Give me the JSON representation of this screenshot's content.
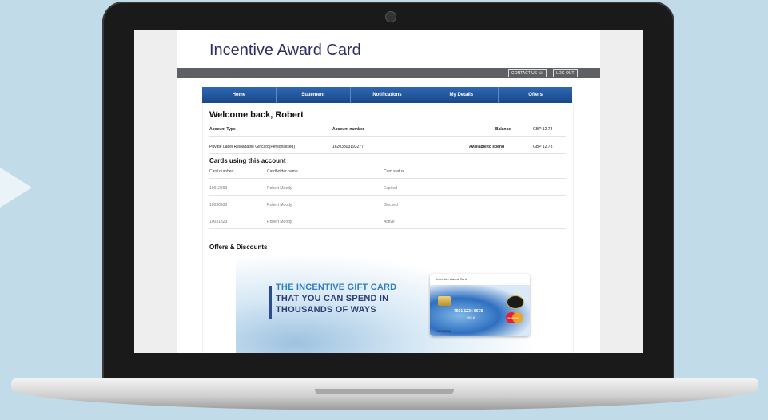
{
  "header": {
    "brand": "Incentive Award Card",
    "contact_label": "CONTACT US",
    "logout_label": "LOG OUT"
  },
  "nav": {
    "items": [
      "Home",
      "Statement",
      "Notifications",
      "My Details",
      "Offers"
    ]
  },
  "account": {
    "welcome": "Welcome back, Robert",
    "type_header": "Account Type",
    "number_header": "Account number",
    "balance_header": "Balance",
    "balance_value": "GBP 12.73",
    "type_value": "Private Label Reloadable Giftcard(Personalised)",
    "number_value": "16203803193277",
    "available_label": "Available to spend",
    "available_value": "GBP 12.73"
  },
  "cards": {
    "title": "Cards using this account",
    "columns": [
      "Card number",
      "Cardholder name",
      "Card status"
    ],
    "rows": [
      [
        "10012663",
        "Robert Moody",
        "Expired"
      ],
      [
        "10036935",
        "Robert Moody",
        "Blocked"
      ],
      [
        "10031823",
        "Robert Moody",
        "Active"
      ]
    ]
  },
  "offers": {
    "title": "Offers & Discounts",
    "promo_lines": [
      "THE INCENTIVE GIFT CARD",
      "THAT YOU CAN SPEND IN",
      "THOUSANDS OF WAYS"
    ],
    "card_title": "Incentive Award Card",
    "card_number": "7501  1234  5678",
    "card_expiry": "05/16",
    "card_brand": "NRICARD",
    "mastercard_text": "MasterCard"
  },
  "colors": {
    "nav_blue": "#1b4f95",
    "promo_dark": "#2d3e73",
    "promo_accent": "#2f7fc3",
    "brand_text": "#2d2f63"
  }
}
